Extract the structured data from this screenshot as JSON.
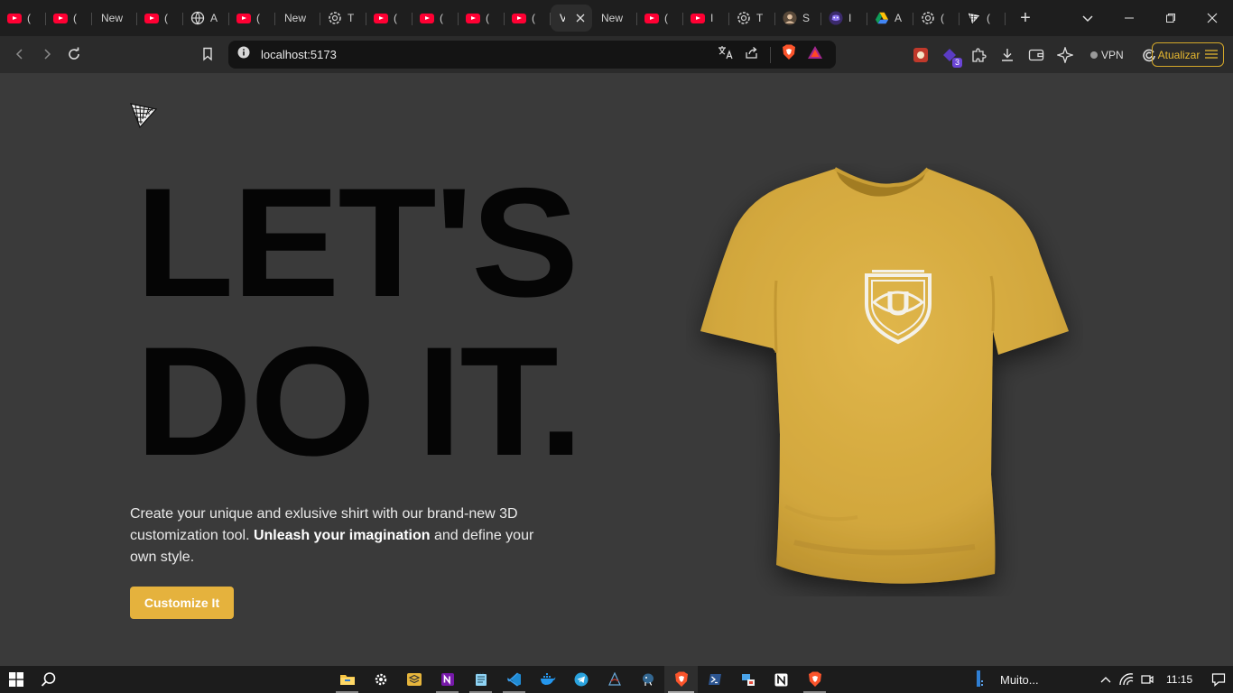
{
  "browser": {
    "tabs": [
      {
        "icon": "youtube",
        "title": "("
      },
      {
        "icon": "youtube",
        "title": "("
      },
      {
        "icon": "none",
        "title": "New"
      },
      {
        "icon": "youtube",
        "title": "("
      },
      {
        "icon": "globe",
        "title": "A"
      },
      {
        "icon": "youtube",
        "title": "("
      },
      {
        "icon": "none",
        "title": "New"
      },
      {
        "icon": "openai",
        "title": "T"
      },
      {
        "icon": "youtube",
        "title": "("
      },
      {
        "icon": "youtube",
        "title": "("
      },
      {
        "icon": "youtube",
        "title": "("
      },
      {
        "icon": "youtube",
        "title": "("
      },
      {
        "icon": "none",
        "title": "V",
        "active": true
      },
      {
        "icon": "none",
        "title": "New"
      },
      {
        "icon": "youtube",
        "title": "("
      },
      {
        "icon": "youtube",
        "title": "I"
      },
      {
        "icon": "openai",
        "title": "T"
      },
      {
        "icon": "avatar",
        "title": "S"
      },
      {
        "icon": "discord",
        "title": "I"
      },
      {
        "icon": "drive",
        "title": "A"
      },
      {
        "icon": "openai",
        "title": "("
      },
      {
        "icon": "triangle-logo",
        "title": "("
      }
    ],
    "new_tab_label": "+",
    "url": "localhost:5173",
    "vpn_label": "VPN",
    "update_label": "Atualizar",
    "extension_badge": "3",
    "accent_color": "#d4a82a"
  },
  "page": {
    "headline_line1": "LET'S",
    "headline_line2": "DO IT.",
    "description_part1": "Create your unique and exlusive shirt with our brand-new 3D customization tool. ",
    "description_bold": "Unleash your imagination",
    "description_part2": " and define your own style.",
    "cta_label": "Customize It",
    "shirt_color": "#d9ae3f",
    "cta_color": "#e5b23d"
  },
  "taskbar": {
    "pinned": [
      "file-explorer",
      "settings",
      "stack-app",
      "onenote",
      "notepad",
      "vscode",
      "docker",
      "telegram",
      "sql-server",
      "postgresql",
      "brave",
      "powershell",
      "network-app",
      "notion",
      "brave-2"
    ],
    "weather_label": "Muito...",
    "time": "11:15"
  }
}
